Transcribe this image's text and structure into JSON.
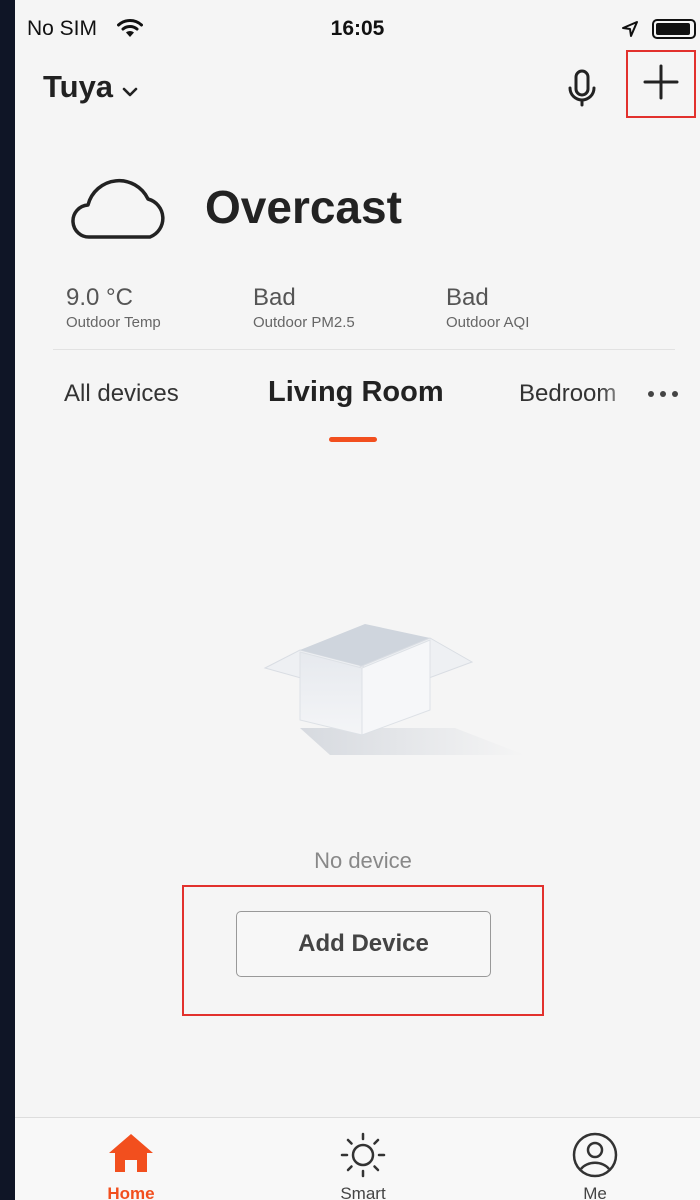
{
  "status_bar": {
    "carrier": "No SIM",
    "time": "16:05"
  },
  "header": {
    "home_name": "Tuya"
  },
  "weather": {
    "condition": "Overcast",
    "metrics": [
      {
        "value": "9.0 °C",
        "label": "Outdoor Temp"
      },
      {
        "value": "Bad",
        "label": "Outdoor PM2.5"
      },
      {
        "value": "Bad",
        "label": "Outdoor AQI"
      }
    ]
  },
  "room_tabs": [
    {
      "label": "All devices",
      "active": false
    },
    {
      "label": "Living Room",
      "active": true
    },
    {
      "label": "Bedroom",
      "active": false
    }
  ],
  "empty_state": {
    "message": "No device",
    "button_label": "Add Device"
  },
  "bottom_nav": [
    {
      "label": "Home",
      "icon": "home-icon",
      "active": true
    },
    {
      "label": "Smart",
      "icon": "sun-icon",
      "active": false
    },
    {
      "label": "Me",
      "icon": "profile-icon",
      "active": false
    }
  ],
  "colors": {
    "accent": "#f24f1e",
    "highlight": "#e2312d",
    "background": "#f5f5f5"
  }
}
